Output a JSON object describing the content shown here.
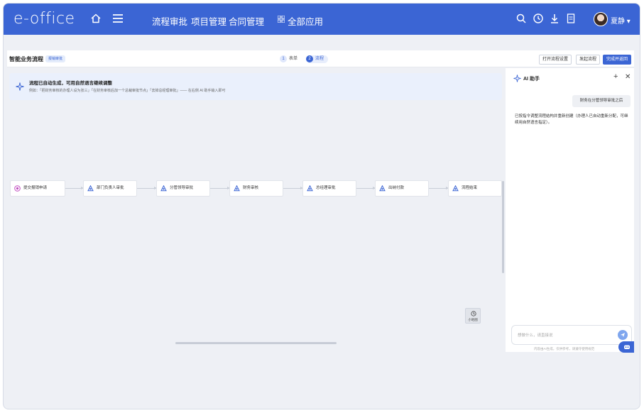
{
  "app": {
    "logo": "e-office",
    "nav": [
      "流程审批",
      "项目管理",
      "合同管理"
    ],
    "all_apps": "全部应用",
    "user": "夏静"
  },
  "header": {
    "title": "智能业务流程",
    "tag": "报销审批",
    "steps": [
      {
        "num": "1",
        "label": "表单"
      },
      {
        "num": "2",
        "label": "流程"
      }
    ],
    "buttons": {
      "settings": "打开流程设置",
      "start": "发起流程",
      "finish": "完成并返回"
    }
  },
  "notice": {
    "title": "流程已自动生成，可用自然语言继续调整",
    "example": "例如：「把财务审核的办理人设为张三」「在财务审核后加一个总裁审批节点」「去掉总经理审批」—— 在右侧 AI 助手输入即可"
  },
  "flow": {
    "nodes": [
      {
        "label": "提交报销申请",
        "icon": "start-node-icon"
      },
      {
        "label": "部门负责人审批",
        "icon": "approval-node-icon"
      },
      {
        "label": "分管领导审批",
        "icon": "approval-node-icon"
      },
      {
        "label": "财务审核",
        "icon": "approval-node-icon"
      },
      {
        "label": "总经理审批",
        "icon": "approval-node-icon"
      },
      {
        "label": "出纳付款",
        "icon": "approval-node-icon"
      },
      {
        "label": "流程结束",
        "icon": "approval-node-icon"
      }
    ],
    "minimap_label": "小地图"
  },
  "ai": {
    "title": "AI 助手",
    "user_message": "财务在分管领导审批之后",
    "reply": "已按指令调整流程结构并重新创建（办理人已自动重新分配，可继续用自然语言指定）。",
    "input_placeholder": "想做什么，请直接说",
    "footer": "内容由AI生成，仅供参考，请遵守使用规范"
  },
  "colors": {
    "brand": "#3b65d4",
    "canvas": "#eef0f5"
  }
}
